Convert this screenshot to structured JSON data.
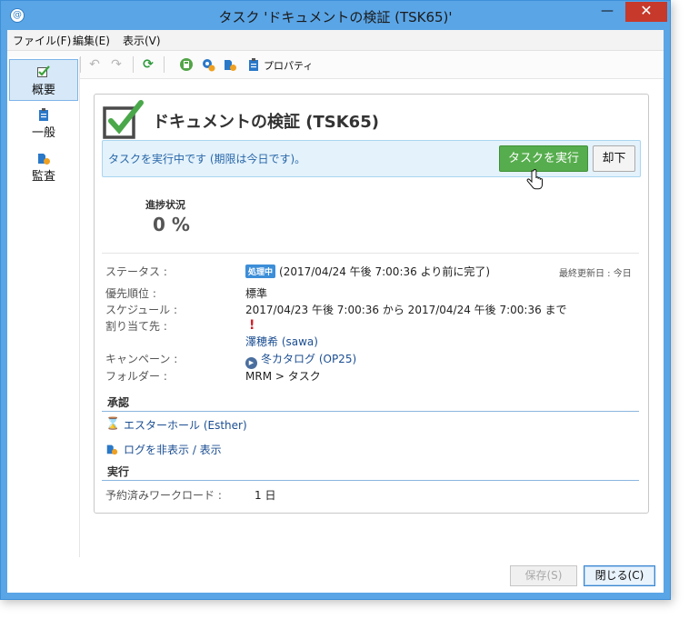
{
  "window": {
    "title": "タスク 'ドキュメントの検証 (TSK65)'"
  },
  "menu": [
    "ファイル(F)",
    "編集(E)",
    "表示(V)"
  ],
  "toolbar": {
    "properties_label": "プロパティ"
  },
  "sidebar": [
    {
      "label": "概要",
      "active": true
    },
    {
      "label": "一般",
      "active": false
    },
    {
      "label": "監査",
      "active": false
    }
  ],
  "task": {
    "title": "ドキュメントの検証 (TSK65)",
    "info_message": "タスクを実行中です (期限は今日です)。",
    "execute_label": "タスクを実行",
    "reject_label": "却下",
    "progress_label": "進捗状況",
    "progress_value": "0 %",
    "last_updated": "最終更新日 : 今日"
  },
  "fields": {
    "status": {
      "label": "ステータス :",
      "badge": "処理中",
      "value": "(2017/04/24 午後 7:00:36 より前に完了)"
    },
    "priority": {
      "label": "優先順位 :",
      "value": "標準"
    },
    "schedule": {
      "label": "スケジュール :",
      "value": "2017/04/23 午後 7:00:36 から 2017/04/24 午後 7:00:36 まで"
    },
    "assignee": {
      "label": "割り当て先 :",
      "value": "澤穂希 (sawa)"
    },
    "campaign": {
      "label": "キャンペーン :",
      "value": "冬カタログ (OP25)"
    },
    "folder": {
      "label": "フォルダー :",
      "value": "MRM > タスク"
    }
  },
  "approval": {
    "heading": "承認",
    "approver": "エスターホール (Esther)",
    "log_toggle": "ログを非表示 / 表示"
  },
  "execution": {
    "heading": "実行",
    "workload_label": "予約済みワークロード :",
    "workload_value": "1 日"
  },
  "footer": {
    "save_label": "保存(S)",
    "close_label": "閉じる(C)"
  },
  "colors": {
    "title_bar": "#5aa5e6",
    "execute_button": "#56ad4d",
    "info_bar": "#e4f2fb",
    "link": "#1b4e92",
    "badge": "#3c8ed8"
  }
}
